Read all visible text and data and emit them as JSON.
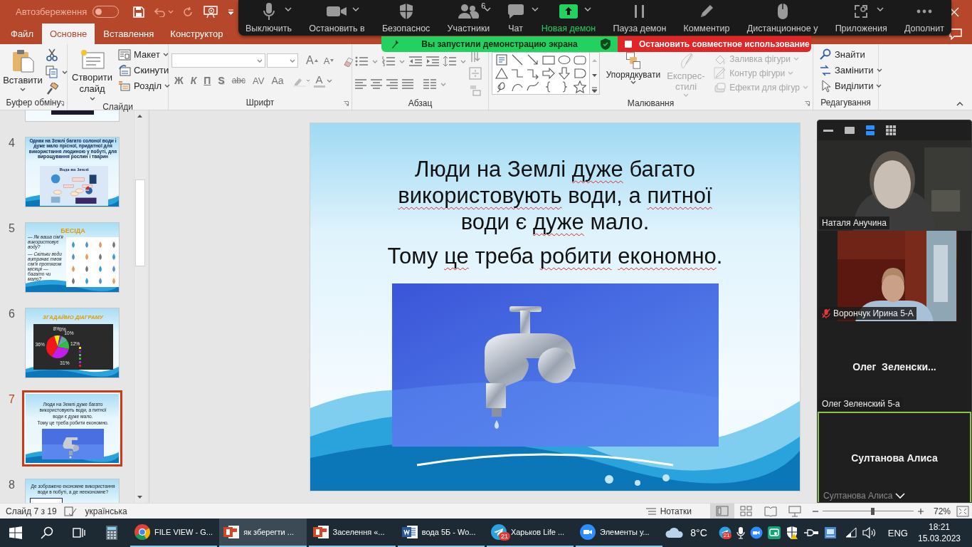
{
  "title_bar": {
    "autosave": {
      "label": "Автозбереження",
      "on": false
    }
  },
  "ribbon_tabs": [
    {
      "label": "Файл",
      "selected": false
    },
    {
      "label": "Основне",
      "selected": true
    },
    {
      "label": "Вставлення",
      "selected": false
    },
    {
      "label": "Конструктор",
      "selected": false
    }
  ],
  "ribbon": {
    "clipboard": {
      "paste": "Вставити",
      "label": "Буфер обміну"
    },
    "slides": {
      "new_slide": "Створити слайд",
      "layout": "Макет",
      "reset": "Скинути",
      "section": "Розділ",
      "label": "Слайди"
    },
    "font": {
      "size_buttons": [
        "A",
        "A"
      ],
      "format_buttons": [
        "Ж",
        "К",
        "П",
        "S",
        "abc",
        "AV",
        "Aa"
      ],
      "font_color": "A",
      "label": "Шрифт"
    },
    "paragraph": {
      "label": "Абзац"
    },
    "drawing": {
      "arrange": "Упорядкувати",
      "quick_styles": {
        "label": "Експрес-стилі",
        "disabled": true
      },
      "shape_commands": [
        {
          "label": "Заливка фігури",
          "disabled": true
        },
        {
          "label": "Контур фігури",
          "disabled": true
        },
        {
          "label": "Ефекти для фігур",
          "disabled": true
        }
      ],
      "label": "Малювання"
    },
    "editing": {
      "commands": [
        {
          "kind": "find",
          "label": "Знайти",
          "menu": false
        },
        {
          "kind": "replace",
          "label": "Замінити",
          "menu": true
        },
        {
          "kind": "select",
          "label": "Виділити",
          "menu": true
        }
      ],
      "label": "Редагування"
    }
  },
  "thumbnails": [
    {
      "kind": "cut"
    },
    {
      "number": "4",
      "selected": false,
      "kind": "scheme",
      "title": "Однак на Землі багато солоної води і дуже мало прісної, придатної для використання людиною у побуті, для вирощування рослин і тварин",
      "caption": "Вода на Землі"
    },
    {
      "number": "5",
      "selected": false,
      "kind": "icons",
      "title": "БЕСІДА",
      "lines": [
        "— Як ваша сім'я використовує воду?",
        "— Скільки води витрачає твоя сім'я протягом місяця — багато чи мало?"
      ]
    },
    {
      "number": "6",
      "selected": false,
      "kind": "pie",
      "title": "ЗГАДАЙМО ДІАГРАМУ",
      "chart_data": {
        "type": "pie",
        "values": [
          8,
          3,
          10,
          12,
          31,
          36
        ],
        "value_labels": [
          "8%",
          "3%",
          "10%",
          "12%",
          "31%",
          "36%"
        ]
      }
    },
    {
      "number": "7",
      "selected": true,
      "kind": "text_image",
      "lines": [
        "Люди на Землі дуже багато використовують води, а питної води є дуже мало.",
        "Тому це треба робити економно."
      ]
    },
    {
      "number": "8",
      "selected": false,
      "kind": "question",
      "title": "Де зображено економне використання води в побуті, а де неекономне?"
    }
  ],
  "slide": {
    "paragraphs": [
      [
        {
          "text": "Люди на Землі ",
          "misspelled": false
        },
        {
          "text": "дуже",
          "misspelled": true
        },
        {
          "text": " багато ",
          "misspelled": false
        },
        {
          "text": "використовують",
          "misspelled": true
        },
        {
          "text": " води, а ",
          "misspelled": false
        },
        {
          "text": "питної",
          "misspelled": true
        },
        {
          "text": " води є ",
          "misspelled": false
        },
        {
          "text": "дуже",
          "misspelled": true
        },
        {
          "text": " мало.",
          "misspelled": false
        }
      ],
      [
        {
          "text": "Тому ",
          "misspelled": false
        },
        {
          "text": "це",
          "misspelled": true
        },
        {
          "text": " треба ",
          "misspelled": false
        },
        {
          "text": "робити",
          "misspelled": true
        },
        {
          "text": " економно",
          "misspelled": true
        },
        {
          "text": ".",
          "misspelled": false
        }
      ]
    ]
  },
  "status_bar": {
    "slide_counter": "Слайд 7 з 19",
    "language": "українська",
    "notes": "Нотатки",
    "views": [
      {
        "kind": "normal",
        "selected": true
      },
      {
        "kind": "sorter",
        "selected": false
      },
      {
        "kind": "reading",
        "selected": false
      },
      {
        "kind": "slideshow",
        "selected": false
      }
    ],
    "zoom": {
      "level": 0.55,
      "reading": "72%"
    }
  },
  "taskbar": {
    "apps": [
      {
        "kind": "chrome",
        "label": "FILE VIEW - G...",
        "selected": false
      },
      {
        "kind": "powerpoint",
        "label": "як зберегти ...",
        "selected": true
      },
      {
        "kind": "powerpoint",
        "label": "Заселення «...",
        "selected": false
      },
      {
        "kind": "word",
        "label": "вода 5Б - Wo...",
        "selected": false
      },
      {
        "kind": "telegram",
        "label": "Харьков Life ...",
        "badge": "21",
        "selected": false
      },
      {
        "kind": "zoom",
        "label": "Элементы у...",
        "selected": false
      }
    ],
    "weather": "8°C",
    "tray_badge": "21",
    "language": "ENG",
    "time": "18:21",
    "date": "15.03.2023"
  },
  "zoom_toolbar": {
    "items": [
      {
        "kind": "mic",
        "label": "Выключить",
        "menu": true
      },
      {
        "kind": "video",
        "label": "Остановить в",
        "menu": true
      },
      {
        "kind": "security",
        "label": "Безопаснос",
        "menu": false
      },
      {
        "kind": "participants",
        "label": "Участники",
        "count": "6",
        "menu": true
      },
      {
        "kind": "chat",
        "label": "Чат",
        "menu": true
      },
      {
        "kind": "share",
        "label": "Новая демон",
        "menu": true
      },
      {
        "kind": "pause",
        "label": "Пауза демон",
        "menu": false
      },
      {
        "kind": "annotate",
        "label": "Комментир",
        "menu": false
      },
      {
        "kind": "remote",
        "label": "Дистанционное у",
        "menu": false
      },
      {
        "kind": "apps",
        "label": "Приложения",
        "menu": true
      },
      {
        "kind": "more",
        "label": "Дополнит",
        "menu": false
      }
    ]
  },
  "share_banner": {
    "status": "Вы запустили демонстрацию экрана",
    "stop": "Остановить совместное использование"
  },
  "video_panel": {
    "views": [
      {
        "kind": "minimize",
        "selected": false
      },
      {
        "kind": "speaker",
        "selected": false
      },
      {
        "kind": "strip",
        "selected": true
      },
      {
        "kind": "grid",
        "selected": false
      }
    ],
    "tiles": [
      {
        "kind": "video",
        "name": "Наталя Анучина",
        "muted": false,
        "active": false
      },
      {
        "kind": "video",
        "name": "Ворончук Ирина 5-А",
        "muted": true,
        "active": false
      },
      {
        "kind": "avatar",
        "display": "Олег  Зеленски...",
        "name": "Олег Зеленский 5-а",
        "muted": false,
        "active": false
      },
      {
        "kind": "avatar",
        "display": "Султанова Алиса",
        "name": "Султанова Алиса",
        "muted": false,
        "active": true
      }
    ]
  }
}
